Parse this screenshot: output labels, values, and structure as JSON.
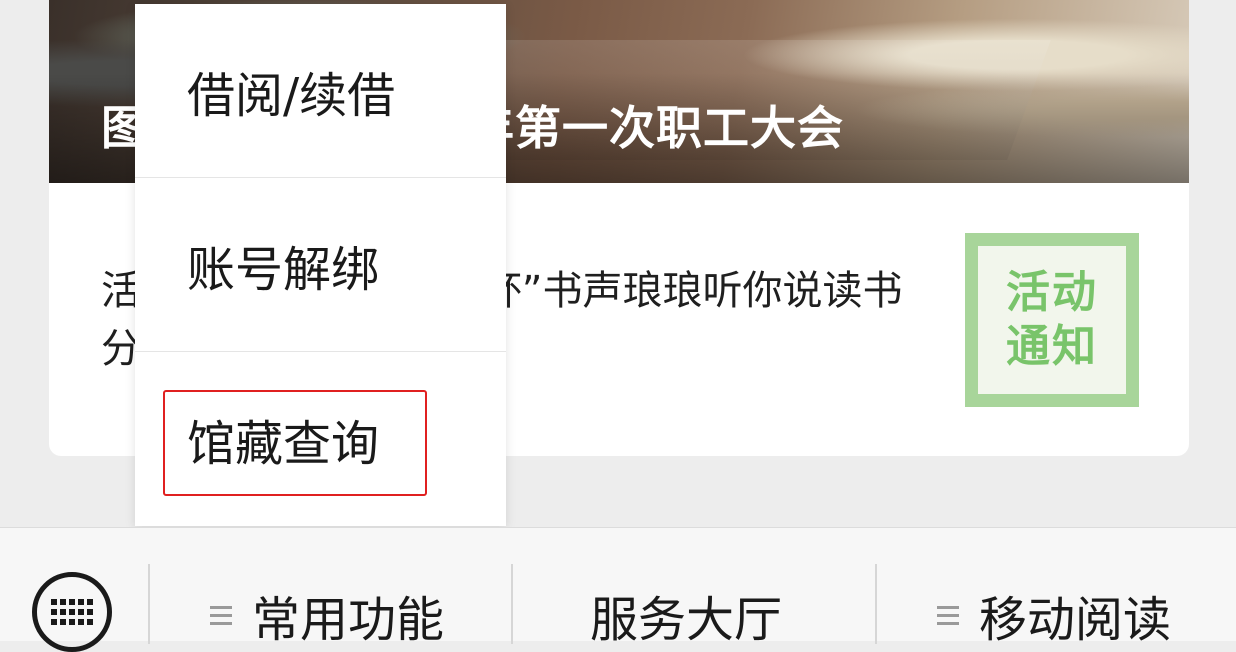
{
  "article": {
    "hero_title": "图书馆召开2021年第一次职工大会",
    "text": "活动通知｜“中文在线杯”书声琅琅听你说读书分享活动来啦",
    "thumbnail": {
      "line1": "活动",
      "line2": "通知"
    }
  },
  "popup_menu": {
    "items": [
      {
        "label": "借阅/续借"
      },
      {
        "label": "账号解绑"
      },
      {
        "label": "馆藏查询",
        "highlighted": true
      }
    ]
  },
  "bottom_bar": {
    "tabs": [
      {
        "label": "常用功能",
        "icon": "menu-icon"
      },
      {
        "label": "服务大厅"
      },
      {
        "label": "移动阅读",
        "icon": "menu-icon"
      }
    ],
    "keyboard_icon": "keyboard-icon"
  },
  "colors": {
    "highlight": "#e02020",
    "thumbnail_green": "#a8d59a"
  }
}
